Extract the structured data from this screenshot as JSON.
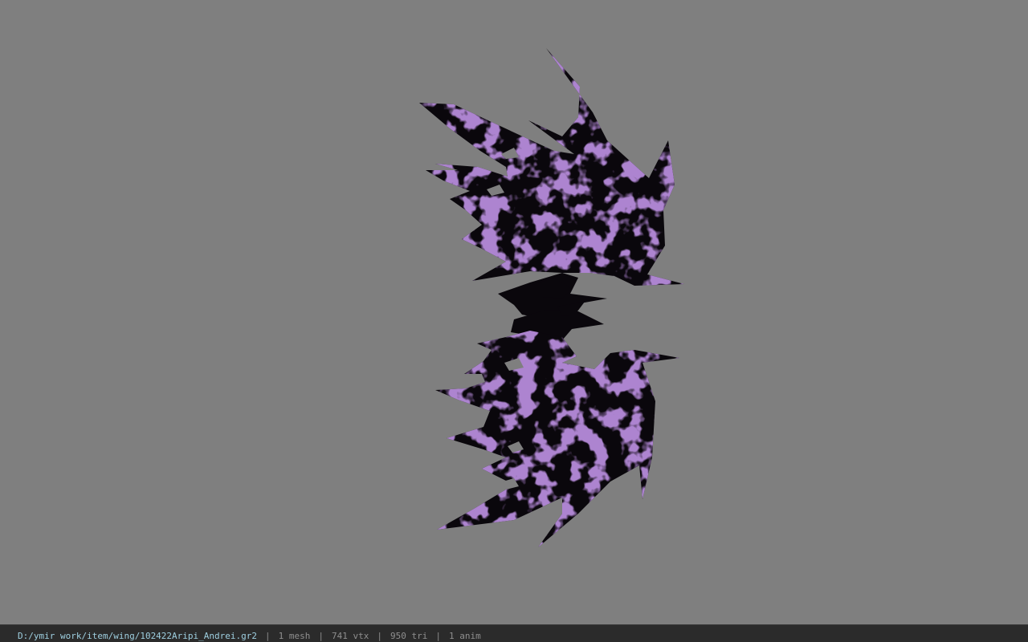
{
  "viewer": {
    "background_color": "#7f7f7f",
    "model_colors": {
      "base": "#0a070c",
      "veins": "#6a3aa0"
    }
  },
  "status": {
    "file_path": "D:/ymir work/item/wing/102422Aripi_Andrei.gr2",
    "separator": "|",
    "mesh": "1 mesh",
    "vertices": "741 vtx",
    "triangles": "950 tri",
    "animations": "1 anim"
  }
}
